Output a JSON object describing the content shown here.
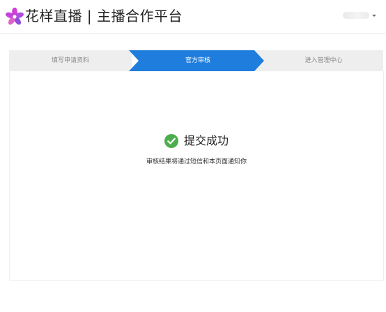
{
  "header": {
    "brand": "花样直播 | 主播合作平台",
    "logo_icon": "flower-logo-icon",
    "user_caret_icon": "caret-down-icon"
  },
  "steps": [
    {
      "label": "填写申请资料",
      "active": false
    },
    {
      "label": "官方审核",
      "active": true
    },
    {
      "label": "进入管理中心",
      "active": false
    }
  ],
  "result": {
    "status_icon": "check-circle-icon",
    "title": "提交成功",
    "description": "审核结果将通过短信和本页面通知你"
  },
  "colors": {
    "active_step": "#1f7dde",
    "inactive_step": "#eeeeee",
    "success": "#4cae4c",
    "logo_primary": "#d23fd6",
    "logo_secondary": "#7c4ddb"
  }
}
